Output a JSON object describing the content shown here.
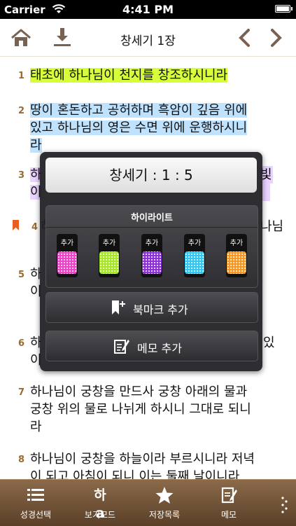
{
  "status_bar": {
    "carrier": "Carrier",
    "time": "4:41 PM"
  },
  "nav": {
    "title": "창세기 1장"
  },
  "verses": [
    {
      "num": "1",
      "lines": [
        "태초에 하나님이 천지를 창조하시니라"
      ],
      "highlight": "green"
    },
    {
      "num": "2",
      "lines": [
        "땅이 혼돈하고 공허하며 흑암이 깊음 위에",
        "있고 하나님의 영은 수면 위에 운행하시니",
        "라"
      ],
      "highlight": "blue"
    },
    {
      "num": "3",
      "lines": [
        "하",
        "이"
      ],
      "highlight": "purple",
      "tail": [
        "빛",
        ""
      ]
    },
    {
      "num": "4",
      "lines": [
        "하"
      ],
      "tail": [
        "나님"
      ],
      "bookmark": true
    },
    {
      "num": "5",
      "lines": [
        "하",
        "이"
      ],
      "tail": [
        "",
        ""
      ]
    },
    {
      "num": "6",
      "lines": [
        "하",
        "이"
      ],
      "tail": [
        "있",
        ""
      ]
    },
    {
      "num": "7",
      "lines": [
        "하나님이 궁창을 만드사 궁창 아래의 물과",
        "궁창 위의 물로 나뉘게 하시니 그대로 되니",
        "라"
      ]
    },
    {
      "num": "8",
      "lines": [
        "하나님이 궁창을 하늘이라 부르시니라 저녁",
        "이 되고 아침이 되니 이는 둘째 날이니라"
      ]
    }
  ],
  "popup": {
    "reference": "창세기 : 1 : 5",
    "highlight_title": "하이라이트",
    "swatches": [
      {
        "label": "추가",
        "color": "#f03fc8"
      },
      {
        "label": "추가",
        "color": "#a4e81f"
      },
      {
        "label": "추가",
        "color": "#8a2fd6"
      },
      {
        "label": "추가",
        "color": "#2fc7f5"
      },
      {
        "label": "추가",
        "color": "#f7961e"
      }
    ],
    "bookmark_label": "북마크 추가",
    "memo_label": "메모 추가"
  },
  "tabs": [
    {
      "label": "성경선택",
      "icon": "list-icon"
    },
    {
      "label": "보기모드",
      "icon": "view-mode-icon",
      "icon_text": "하a"
    },
    {
      "label": "저장목록",
      "icon": "star-icon"
    },
    {
      "label": "메모",
      "icon": "memo-icon"
    }
  ]
}
